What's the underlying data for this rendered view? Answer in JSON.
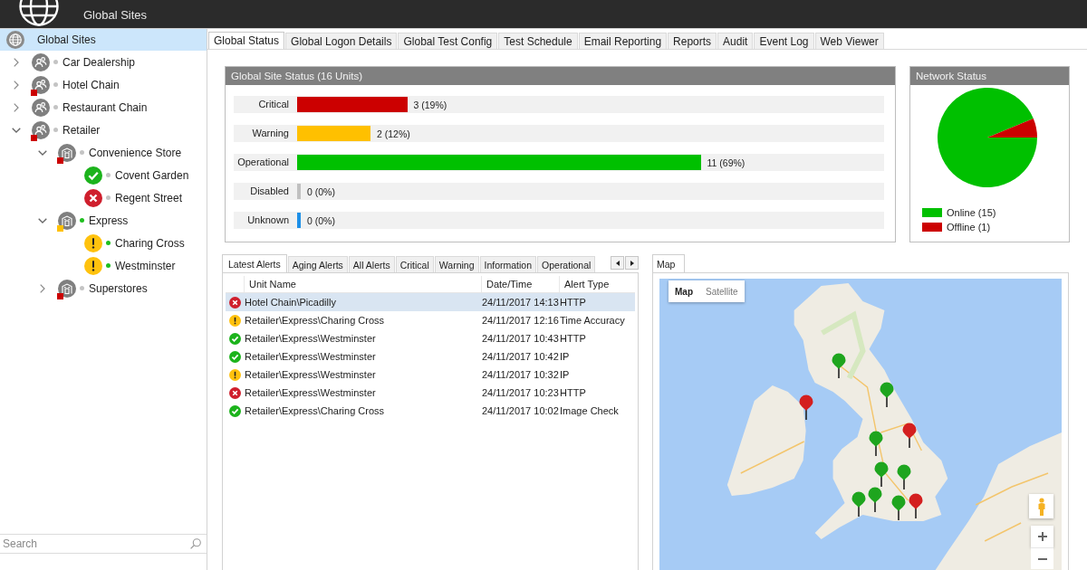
{
  "header": {
    "subtitle": "Global Sites"
  },
  "tree": {
    "root": {
      "label": "Global Sites",
      "selected": true
    },
    "items": [
      {
        "kind": "group",
        "label": "Car Dealership",
        "expanded": false,
        "selected": false,
        "critical": false,
        "warning": false,
        "color": "#c4c4c4"
      },
      {
        "kind": "group",
        "label": "Hotel Chain",
        "expanded": false,
        "selected": false,
        "critical": true,
        "warning": false,
        "color": "#c4c4c4"
      },
      {
        "kind": "group",
        "label": "Restaurant Chain",
        "expanded": false,
        "selected": false,
        "critical": false,
        "warning": false,
        "color": "#c4c4c4"
      },
      {
        "kind": "group",
        "label": "Retailer",
        "expanded": true,
        "selected": false,
        "critical": true,
        "warning": false,
        "color": "#c4c4c4",
        "children": [
          {
            "kind": "site",
            "label": "Convenience Store",
            "expanded": true,
            "selected": false,
            "critical": true,
            "warning": false,
            "color": "#c4c4c4",
            "children": [
              {
                "kind": "ok",
                "label": "Covent Garden",
                "selected": false,
                "color": "#c4c4c4"
              },
              {
                "kind": "error",
                "label": "Regent Street",
                "selected": false,
                "color": "#c4c4c4"
              }
            ]
          },
          {
            "kind": "site",
            "label": "Express",
            "expanded": true,
            "selected": false,
            "critical": false,
            "warning": true,
            "color": "#1fbf1f",
            "children": [
              {
                "kind": "warning",
                "label": "Charing Cross",
                "selected": false,
                "color": "#1fbf1f"
              },
              {
                "kind": "warning",
                "label": "Westminster",
                "selected": false,
                "color": "#1fbf1f"
              }
            ]
          },
          {
            "kind": "site",
            "label": "Superstores",
            "expanded": false,
            "selected": false,
            "critical": true,
            "warning": false,
            "color": "#c4c4c4"
          }
        ]
      }
    ]
  },
  "search": {
    "placeholder": "Search"
  },
  "main_tabs": [
    {
      "label": "Global Status",
      "selected": true
    },
    {
      "label": "Global Logon Details",
      "selected": false
    },
    {
      "label": "Global Test Config",
      "selected": false
    },
    {
      "label": "Test Schedule",
      "selected": false
    },
    {
      "label": "Email Reporting",
      "selected": false
    },
    {
      "label": "Reports",
      "selected": false
    },
    {
      "label": "Audit",
      "selected": false
    },
    {
      "label": "Event Log",
      "selected": false
    },
    {
      "label": "Web Viewer",
      "selected": false
    }
  ],
  "site_status": {
    "title": "Global Site Status (16 Units)",
    "rows": [
      {
        "label": "Critical",
        "color": "#cc0000",
        "level": 0.1875,
        "reading": "3 (19%)"
      },
      {
        "label": "Warning",
        "color": "#ffc000",
        "level": 0.125,
        "reading": "2 (12%)"
      },
      {
        "label": "Operational",
        "color": "#00c000",
        "level": 0.6875,
        "reading": "11 (69%)"
      },
      {
        "label": "Disabled",
        "color": "#c0c0c0",
        "level": 0,
        "reading": "0 (0%)"
      },
      {
        "label": "Unknown",
        "color": "#1e90e8",
        "level": 0,
        "reading": "0 (0%)"
      }
    ]
  },
  "network": {
    "title": "Network Status",
    "chart_data": {
      "type": "pie",
      "categories": [
        "Online (15)",
        "Offline (1)"
      ],
      "values": [
        15,
        1
      ]
    },
    "legend": [
      {
        "color": "#00c000"
      },
      {
        "color": "#cc0000"
      }
    ]
  },
  "alerts": {
    "tabs": [
      {
        "label": "Latest Alerts",
        "selected": true
      },
      {
        "label": "Aging Alerts",
        "selected": false
      },
      {
        "label": "All Alerts",
        "selected": false
      },
      {
        "label": "Critical",
        "selected": false
      },
      {
        "label": "Warning",
        "selected": false
      },
      {
        "label": "Information",
        "selected": false
      },
      {
        "label": "Operational",
        "selected": false
      }
    ],
    "columns": [
      "Unit Name",
      "Date/Time",
      "Alert Type"
    ],
    "rows": [
      {
        "kind": "error",
        "unit": "Hotel Chain\\Picadilly",
        "datetime": "24/11/2017 14:13",
        "type": "HTTP",
        "selected": true
      },
      {
        "kind": "warning",
        "unit": "Retailer\\Express\\Charing Cross",
        "datetime": "24/11/2017 12:16",
        "type": "Time Accuracy",
        "selected": false
      },
      {
        "kind": "ok",
        "unit": "Retailer\\Express\\Westminster",
        "datetime": "24/11/2017 10:43",
        "type": "HTTP",
        "selected": false
      },
      {
        "kind": "ok",
        "unit": "Retailer\\Express\\Westminster",
        "datetime": "24/11/2017 10:42",
        "type": "IP",
        "selected": false
      },
      {
        "kind": "warning",
        "unit": "Retailer\\Express\\Westminster",
        "datetime": "24/11/2017 10:32",
        "type": "IP",
        "selected": false
      },
      {
        "kind": "error",
        "unit": "Retailer\\Express\\Westminster",
        "datetime": "24/11/2017 10:23",
        "type": "HTTP",
        "selected": false
      },
      {
        "kind": "ok",
        "unit": "Retailer\\Express\\Charing Cross",
        "datetime": "24/11/2017 10:02",
        "type": "Image Check",
        "selected": false
      }
    ]
  },
  "map": {
    "tab": {
      "label": "Map",
      "selected": true
    },
    "view_buttons": [
      {
        "label": "Map",
        "selected": true
      },
      {
        "label": "Satellite",
        "selected": false
      }
    ],
    "pins": [
      {
        "color": "#1ea51e"
      },
      {
        "color": "#1ea51e"
      },
      {
        "color": "#d41f1f"
      },
      {
        "color": "#1ea51e"
      },
      {
        "color": "#d41f1f"
      },
      {
        "color": "#1ea51e"
      },
      {
        "color": "#1ea51e"
      },
      {
        "color": "#1ea51e"
      },
      {
        "color": "#1ea51e"
      },
      {
        "color": "#1ea51e"
      },
      {
        "color": "#d41f1f"
      }
    ]
  }
}
